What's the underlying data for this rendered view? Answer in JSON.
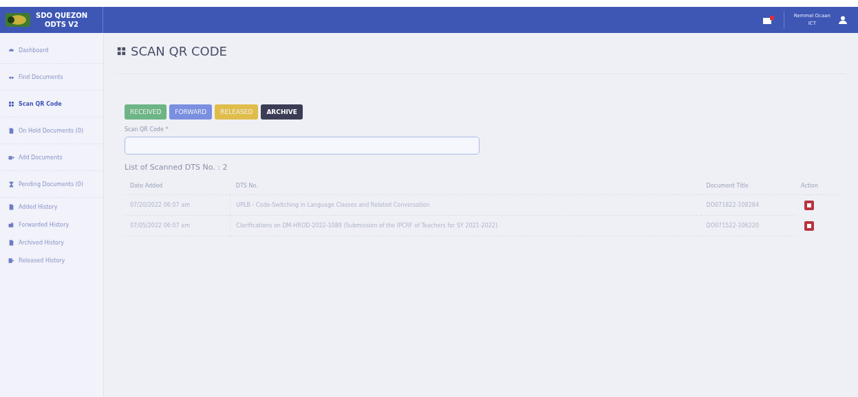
{
  "header": {
    "brand_line_1": "SDO QUEZON",
    "brand_line_2": "ODTS V2",
    "user": {
      "name": "Remmel Ocaan",
      "role": "ICT"
    },
    "mail_unread": true
  },
  "sidebar": {
    "items": [
      {
        "label": "Dashboard",
        "kind": "dashboard",
        "selected": false
      },
      {
        "label": "Find Documents",
        "kind": "find",
        "selected": false
      },
      {
        "label": "Scan QR Code",
        "kind": "qr",
        "selected": true
      },
      {
        "label": "On Hold Documents (0)",
        "kind": "file",
        "selected": false
      },
      {
        "label": "Add Documents",
        "kind": "add",
        "selected": false
      },
      {
        "label": "Pending Documents (0)",
        "kind": "hourglass",
        "selected": false
      },
      {
        "label": "Added History",
        "kind": "file",
        "selected": false
      },
      {
        "label": "Forwarded History",
        "kind": "forward",
        "selected": false
      },
      {
        "label": "Archived History",
        "kind": "file",
        "selected": false
      },
      {
        "label": "Released History",
        "kind": "release",
        "selected": false
      }
    ]
  },
  "page": {
    "title": "SCAN QR CODE",
    "actions": [
      {
        "label": "RECEIVED",
        "color": "#6db585",
        "selected": false
      },
      {
        "label": "FORWARD",
        "color": "#7a8fe0",
        "selected": false
      },
      {
        "label": "RELEASED",
        "color": "#e0bd4a",
        "selected": false
      },
      {
        "label": "ARCHIVE",
        "color": "#3b3c55",
        "selected": true
      }
    ],
    "scan_field": {
      "label": "Scan QR Code *"
    },
    "list_heading": "List of Scanned DTS No. : 2",
    "table": {
      "columns": [
        "Date Added",
        "DTS No.",
        "Document Title",
        "Action"
      ],
      "rows": [
        {
          "date": "07/20/2022 06:07 am",
          "title": "UPLB - Code-Switching in Language Classes and Related Conversation",
          "dts": "DO071822-108284"
        },
        {
          "date": "07/05/2022 06:07 am",
          "title": "Clarifications on DM-HROD-2022-1089 (Submission of the IPCRF of Teachers for SY 2021-2022)",
          "dts": "DO071522-106220"
        }
      ]
    }
  }
}
